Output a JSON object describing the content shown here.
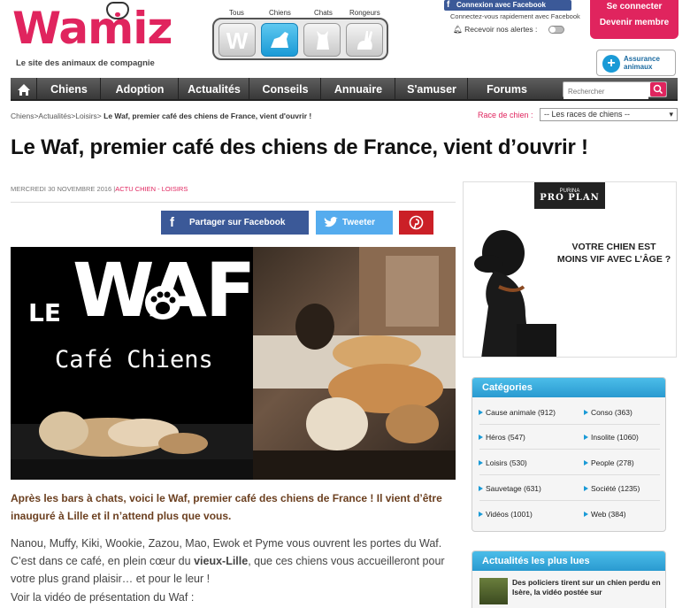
{
  "header": {
    "logo": "Wamiz",
    "tagline": "Le site des animaux de compagnie",
    "animals": [
      "Tous",
      "Chiens",
      "Chats",
      "Rongeurs"
    ],
    "facebook_connect": "Connexion avec Facebook",
    "facebook_sub": "Connectez-vous rapidement avec Facebook",
    "alerts_label": "Recevoir nos alertes :",
    "login_line1": "Se connecter",
    "login_line2": "Devenir membre",
    "insurance_line1": "Assurance",
    "insurance_line2": "animaux"
  },
  "nav": {
    "items": [
      "Chiens",
      "Adoption",
      "Actualités",
      "Conseils",
      "Annuaire",
      "S'amuser",
      "Forums"
    ],
    "search_placeholder": "Rechercher"
  },
  "breadcrumb": {
    "path": "Chiens>Actualités>Loisirs>",
    "current": "Le Waf, premier café des chiens de France, vient d'ouvrir !"
  },
  "race": {
    "label": "Race de chien :",
    "selected": "-- Les races de chiens --"
  },
  "article": {
    "title": "Le Waf, premier café des chiens de France, vient d’ouvrir !",
    "date": "MERCREDI 30 NOVEMBRE 2016",
    "category": "ACTU CHIEN - LOISIRS",
    "share_facebook": "Partager sur Facebook",
    "share_twitter": "Tweeter",
    "image_le": "LE",
    "image_waf": "WAF",
    "image_cafe": "Café Chiens",
    "lead": "Après les bars à chats, voici le Waf, premier café des chiens de France ! Il vient d’être inauguré à Lille et il n’attend plus que vous.",
    "para_before": "Nanou, Muffy, Kiki, Wookie, Zazou, Mao, Ewok et Pyme vous ouvrent les portes du Waf. C’est dans ce café, en plein cœur du ",
    "para_bold": "vieux-Lille",
    "para_after": ", que ces chiens vous accueilleront pour votre plus grand plaisir… et pour le leur !",
    "video_intro": "Voir la vidéo de présentation du Waf :"
  },
  "ad": {
    "brand_top": "PURINA",
    "brand": "PRO PLAN",
    "text": "VOTRE CHIEN EST MOINS VIF AVEC L’ÂGE ?"
  },
  "categories": {
    "title": "Catégories",
    "left": [
      "Cause animale (912)",
      "Héros (547)",
      "Loisirs (530)",
      "Sauvetage (631)",
      "Vidéos (1001)"
    ],
    "right": [
      "Conso (363)",
      "Insolite (1060)",
      "People (278)",
      "Société (1235)",
      "Web (384)"
    ]
  },
  "top_news": {
    "title": "Actualités les plus lues",
    "item": "Des policiers tirent sur un chien perdu en Isère, la vidéo postée sur"
  },
  "colors": {
    "brand_pink": "#e0245e",
    "accent_blue": "#1a9ad6",
    "facebook": "#3b5998",
    "twitter": "#55acee",
    "pinterest": "#cb2027"
  }
}
